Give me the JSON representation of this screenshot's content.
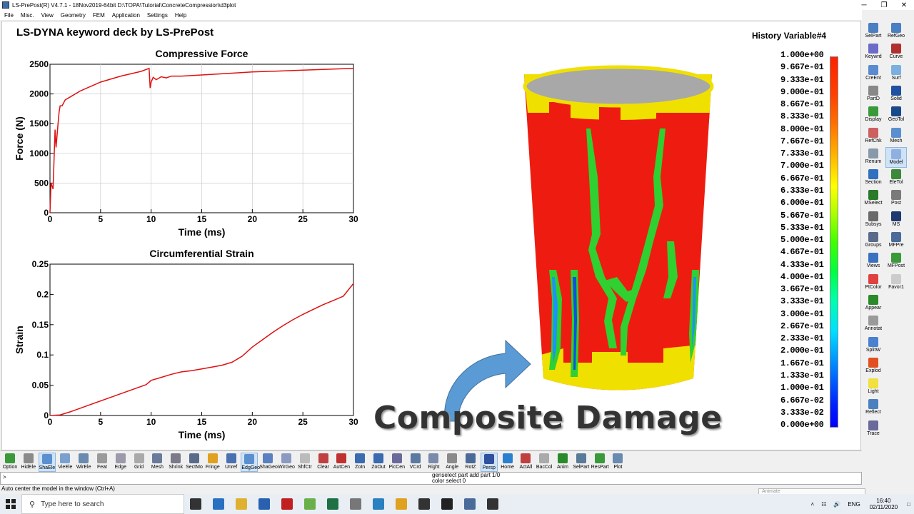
{
  "window": {
    "title": "LS-PrePost(R) V4.7.1 - 18Nov2019-64bit D:\\TOPA\\Tutorial\\ConcreteCompression\\d3plot",
    "minimize": "─",
    "maximize": "❐",
    "close": "✕"
  },
  "menu": [
    "File",
    "Misc.",
    "View",
    "Geometry",
    "FEM",
    "Application",
    "Settings",
    "Help"
  ],
  "viewport": {
    "deck_title": "LS-DYNA keyword deck by LS-PrePost",
    "overlay_caption": "Composite Damage"
  },
  "chart_data": [
    {
      "type": "line",
      "title": "Compressive Force",
      "xlabel": "Time (ms)",
      "ylabel": "Force (N)",
      "xlim": [
        0,
        30
      ],
      "ylim": [
        0,
        2500
      ],
      "x_ticks": [
        "0",
        "5",
        "10",
        "15",
        "20",
        "25",
        "30"
      ],
      "y_ticks": [
        "0",
        "500",
        "1000",
        "1500",
        "2000",
        "2500"
      ],
      "grid": true,
      "color": "#e01010",
      "x": [
        0,
        0.1,
        0.3,
        0.5,
        0.6,
        0.8,
        0.9,
        1.0,
        1.2,
        1.5,
        2.0,
        3.0,
        5.0,
        7.0,
        9.0,
        9.8,
        9.9,
        10.0,
        10.2,
        10.5,
        11.0,
        11.5,
        12.0,
        13,
        15,
        18,
        20,
        25,
        30
      ],
      "y": [
        0,
        500,
        400,
        1400,
        1100,
        1500,
        1700,
        1800,
        1800,
        1900,
        1950,
        2050,
        2200,
        2300,
        2380,
        2430,
        2100,
        2200,
        2280,
        2240,
        2290,
        2270,
        2300,
        2300,
        2320,
        2350,
        2370,
        2400,
        2430
      ]
    },
    {
      "type": "line",
      "title": "Circumferential Strain",
      "xlabel": "Time (ms)",
      "ylabel": "Strain",
      "xlim": [
        0,
        30
      ],
      "ylim": [
        0,
        0.25
      ],
      "x_ticks": [
        "0",
        "5",
        "10",
        "15",
        "20",
        "25",
        "30"
      ],
      "y_ticks": [
        "0",
        "0.05",
        "0.1",
        "0.15",
        "0.2",
        "0.25"
      ],
      "grid": false,
      "color": "#e01010",
      "x": [
        0,
        1,
        2,
        4,
        6,
        8,
        9.5,
        10,
        11,
        12,
        13,
        14,
        15,
        16,
        17,
        18,
        19,
        20,
        21,
        22,
        23,
        24,
        25,
        26,
        27,
        28,
        29,
        30
      ],
      "y": [
        0,
        0.001,
        0.006,
        0.018,
        0.03,
        0.042,
        0.051,
        0.058,
        0.063,
        0.068,
        0.072,
        0.074,
        0.077,
        0.08,
        0.083,
        0.088,
        0.098,
        0.113,
        0.125,
        0.137,
        0.148,
        0.158,
        0.167,
        0.175,
        0.183,
        0.19,
        0.197,
        0.218
      ]
    }
  ],
  "legend": {
    "title": "History Variable#4",
    "labels": [
      "1.000e+00",
      "9.667e-01",
      "9.333e-01",
      "9.000e-01",
      "8.667e-01",
      "8.333e-01",
      "8.000e-01",
      "7.667e-01",
      "7.333e-01",
      "7.000e-01",
      "6.667e-01",
      "6.333e-01",
      "6.000e-01",
      "5.667e-01",
      "5.333e-01",
      "5.000e-01",
      "4.667e-01",
      "4.333e-01",
      "4.000e-01",
      "3.667e-01",
      "3.333e-01",
      "3.000e-01",
      "2.667e-01",
      "2.333e-01",
      "2.000e-01",
      "1.667e-01",
      "1.333e-01",
      "1.000e-01",
      "6.667e-02",
      "3.333e-02",
      "0.000e+00"
    ]
  },
  "right_panel": [
    {
      "label": "SelPart",
      "color": "#4a7fc1"
    },
    {
      "label": "RefGeo",
      "color": "#4a7fc1"
    },
    {
      "label": "Keywrd",
      "color": "#6b6bc8"
    },
    {
      "label": "Curve",
      "color": "#b03030"
    },
    {
      "label": "CreEnt",
      "color": "#5a8ad0"
    },
    {
      "label": "Surf",
      "color": "#7ab0e0"
    },
    {
      "label": "PartD",
      "color": "#888888"
    },
    {
      "label": "Solid",
      "color": "#2050a0"
    },
    {
      "label": "Display",
      "color": "#3a9a3a"
    },
    {
      "label": "GeoTol",
      "color": "#1a4a8a"
    },
    {
      "label": "RefChk",
      "color": "#cc6060"
    },
    {
      "label": "Mesh",
      "color": "#5a90d0"
    },
    {
      "label": "Renum",
      "color": "#8899aa"
    },
    {
      "label": "Model",
      "color": "#90b0e0"
    },
    {
      "label": "Section",
      "color": "#3070c0"
    },
    {
      "label": "EleTol",
      "color": "#3a8a3a"
    },
    {
      "label": "MSelect",
      "color": "#2a7a2a"
    },
    {
      "label": "Post",
      "color": "#7a7a7a"
    },
    {
      "label": "Subsys",
      "color": "#6a6a6a"
    },
    {
      "label": "MS",
      "color": "#203a70"
    },
    {
      "label": "Groups",
      "color": "#5a6a8a"
    },
    {
      "label": "MFPre",
      "color": "#4a6a9a"
    },
    {
      "label": "Views",
      "color": "#3a70c0"
    },
    {
      "label": "MFPost",
      "color": "#3a9a3a"
    },
    {
      "label": "PtColor",
      "color": "#e04040"
    },
    {
      "label": "Favor1",
      "color": "#cccccc"
    },
    {
      "label": "Appear",
      "color": "#2a8a2a"
    },
    {
      "label": "Annotat",
      "color": "#9a9a9a"
    },
    {
      "label": "SplitW",
      "color": "#4a80d0"
    },
    {
      "label": "Explod",
      "color": "#e05020"
    },
    {
      "label": "Light",
      "color": "#f0e040"
    },
    {
      "label": "Reflect",
      "color": "#4a80c0"
    },
    {
      "label": "Trace",
      "color": "#6a6a9a"
    }
  ],
  "bottom_toolbar": [
    {
      "label": "Option",
      "color": "#3a9a3a"
    },
    {
      "label": "HidEle",
      "color": "#8a8a8a"
    },
    {
      "label": "ShaEle",
      "color": "#5a90d0"
    },
    {
      "label": "VieEle",
      "color": "#7aa0d0"
    },
    {
      "label": "WirEle",
      "color": "#6a8ab0"
    },
    {
      "label": "Feat",
      "color": "#9a9a9a"
    },
    {
      "label": "Edge",
      "color": "#9a9aaa"
    },
    {
      "label": "Grid",
      "color": "#aaaaaa"
    },
    {
      "label": "Mesh",
      "color": "#6a7a9a"
    },
    {
      "label": "Shrink",
      "color": "#7a7a8a"
    },
    {
      "label": "SectMo",
      "color": "#5a6a8a"
    },
    {
      "label": "Fringe",
      "color": "#e0a020"
    },
    {
      "label": "Unref",
      "color": "#4a70b0"
    },
    {
      "label": "EdgGeo",
      "color": "#5a90d0"
    },
    {
      "label": "ShaGeo",
      "color": "#5a80c0"
    },
    {
      "label": "WirGeo",
      "color": "#8a9ac0"
    },
    {
      "label": "ShfCtr",
      "color": "#bbbbbb"
    },
    {
      "label": "Clear",
      "color": "#c04040"
    },
    {
      "label": "AutCen",
      "color": "#c03030"
    },
    {
      "label": "ZoIn",
      "color": "#3a6ab0"
    },
    {
      "label": "ZoOut",
      "color": "#3a6ab0"
    },
    {
      "label": "PicCen",
      "color": "#6a6a9a"
    },
    {
      "label": "VCrd",
      "color": "#5a7aa0"
    },
    {
      "label": "Right",
      "color": "#7a8aaa"
    },
    {
      "label": "Angle",
      "color": "#8a8a8a"
    },
    {
      "label": "RotZ",
      "color": "#4a6a9a"
    },
    {
      "label": "Persp",
      "color": "#3050a0"
    },
    {
      "label": "Home",
      "color": "#2a80d0"
    },
    {
      "label": "ActAll",
      "color": "#c04040"
    },
    {
      "label": "BacCol",
      "color": "#aaaaaa"
    },
    {
      "label": "Anim",
      "color": "#2a8a2a"
    },
    {
      "label": "SelPart",
      "color": "#5a7a9a"
    },
    {
      "label": "ResPart",
      "color": "#3a9a3a"
    },
    {
      "label": "Plot",
      "color": "#6a8ab0"
    }
  ],
  "toolbar_extra": {
    "shft_label": "Shft",
    "ctrl_label": "Ctrl",
    "angle_value": "-15",
    "unref_symbol": "U"
  },
  "command": {
    "prompt": ">",
    "history": [
      "genselect part add part 1/0",
      "color select 0"
    ]
  },
  "status": {
    "message": "Auto center the model in the window (Ctrl+A)",
    "animate": "Animate"
  },
  "taskbar": {
    "search_placeholder": "Type here to search",
    "apps": [
      {
        "name": "task-view",
        "color": "#333333"
      },
      {
        "name": "edge",
        "color": "#2a70c0"
      },
      {
        "name": "file-explorer",
        "color": "#e0b030"
      },
      {
        "name": "mail",
        "color": "#2a60b0"
      },
      {
        "name": "acrobat",
        "color": "#c02020"
      },
      {
        "name": "notepad-plus",
        "color": "#6ab04a"
      },
      {
        "name": "excel",
        "color": "#1e7145"
      },
      {
        "name": "paint",
        "color": "#777777"
      },
      {
        "name": "ls-app",
        "color": "#2a80c0"
      },
      {
        "name": "chrome",
        "color": "#e0a020"
      },
      {
        "name": "lsprepost",
        "color": "#333333"
      },
      {
        "name": "terminal",
        "color": "#222222"
      },
      {
        "name": "calculator",
        "color": "#4a6a9a"
      },
      {
        "name": "lsprepost-active",
        "color": "#333333"
      }
    ],
    "tray_lang": "ENG",
    "time": "16:40",
    "date": "02/11/2020"
  }
}
